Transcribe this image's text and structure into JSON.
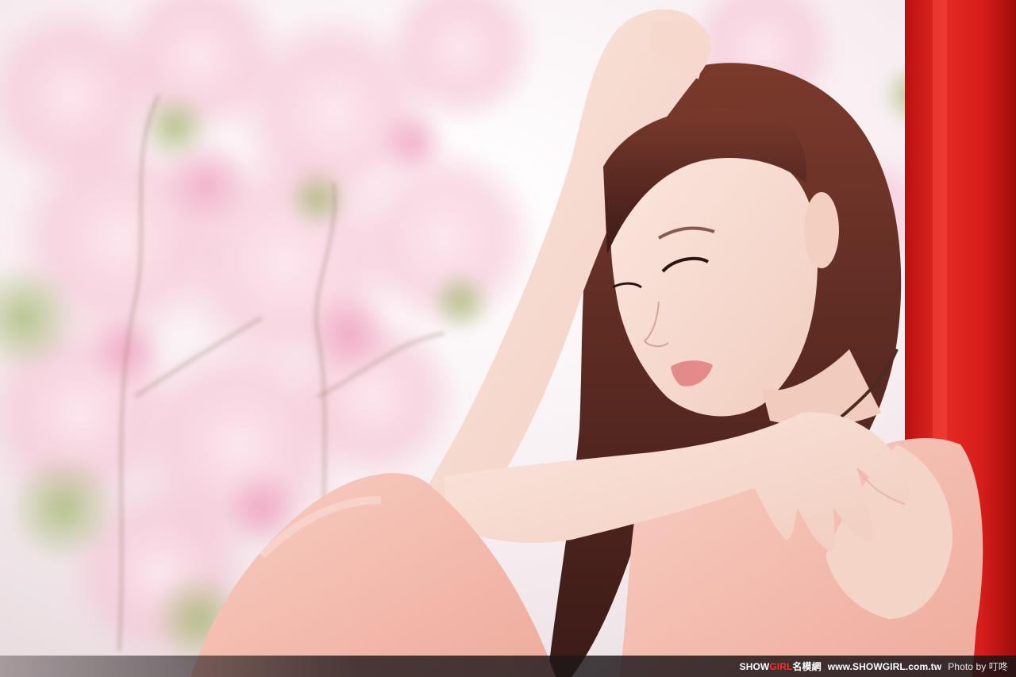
{
  "watermark": {
    "brand_prefix": "SHOW",
    "brand_accent": "GIRL",
    "brand_suffix": "名模網",
    "site": "www.SHOWGIRL.com.tw",
    "photo_credit_label": "Photo by",
    "photographer": "叮咚"
  },
  "colors": {
    "pillar_red": "#d81e1e",
    "dress_pink": "#f2b9ad",
    "hair_brown": "#5a2a22",
    "blossom_pink": "#f6c9d8",
    "accent_red_text": "#ff2a2a"
  }
}
